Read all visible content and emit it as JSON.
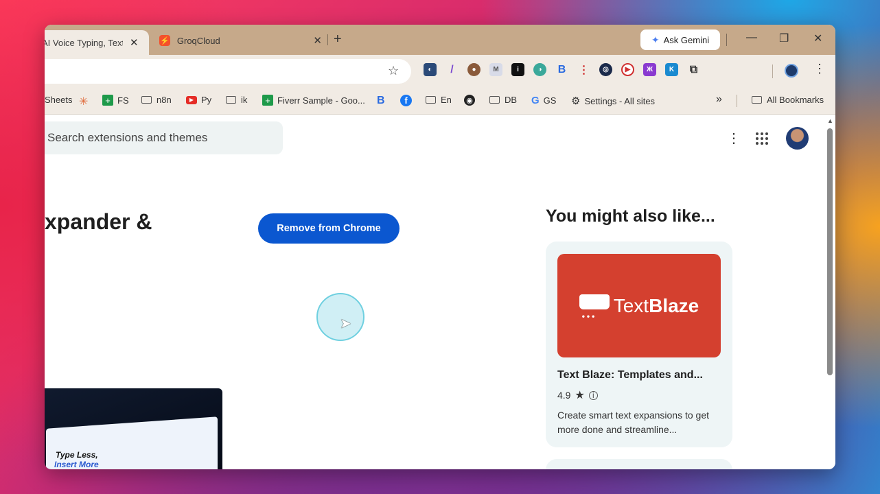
{
  "tabs": [
    {
      "title": "AI Voice Typing, Text Expander"
    },
    {
      "title": "GroqCloud",
      "favicon": "G"
    }
  ],
  "header": {
    "gemini_label": "Ask Gemini"
  },
  "bookmarks": [
    {
      "label": "Sheets",
      "icon": ""
    },
    {
      "label": "",
      "icon": "✳"
    },
    {
      "label": "FS",
      "icon": "+"
    },
    {
      "label": "n8n",
      "icon": "folder"
    },
    {
      "label": "Py",
      "icon": "▶"
    },
    {
      "label": "ik",
      "icon": "folder"
    },
    {
      "label": "Fiverr Sample - Goo...",
      "icon": "+"
    },
    {
      "label": "",
      "icon": "B"
    },
    {
      "label": "",
      "icon": "f"
    },
    {
      "label": "En",
      "icon": "folder"
    },
    {
      "label": "",
      "icon": "◉"
    },
    {
      "label": "DB",
      "icon": "folder"
    },
    {
      "label": "GS",
      "icon": "G"
    },
    {
      "label": "Settings - All sites",
      "icon": "⚙"
    },
    {
      "label": "All Bookmarks",
      "icon": "folder"
    }
  ],
  "search": {
    "placeholder": "Search extensions and themes"
  },
  "main": {
    "heading": "xpander &",
    "remove_button": "Remove from Chrome",
    "promo_line1": "Type Less,",
    "promo_line2": "Insert More"
  },
  "sidebar": {
    "title": "You might also like...",
    "card": {
      "logo_text_light": "Text",
      "logo_text_bold": "Blaze",
      "name": "Text Blaze: Templates and...",
      "rating": "4.9",
      "description": "Create smart text expansions to get more done and streamline..."
    }
  },
  "colors": {
    "accent": "#0b57d0",
    "card_bg": "#eef5f6",
    "thumb_bg": "#d4402f"
  }
}
